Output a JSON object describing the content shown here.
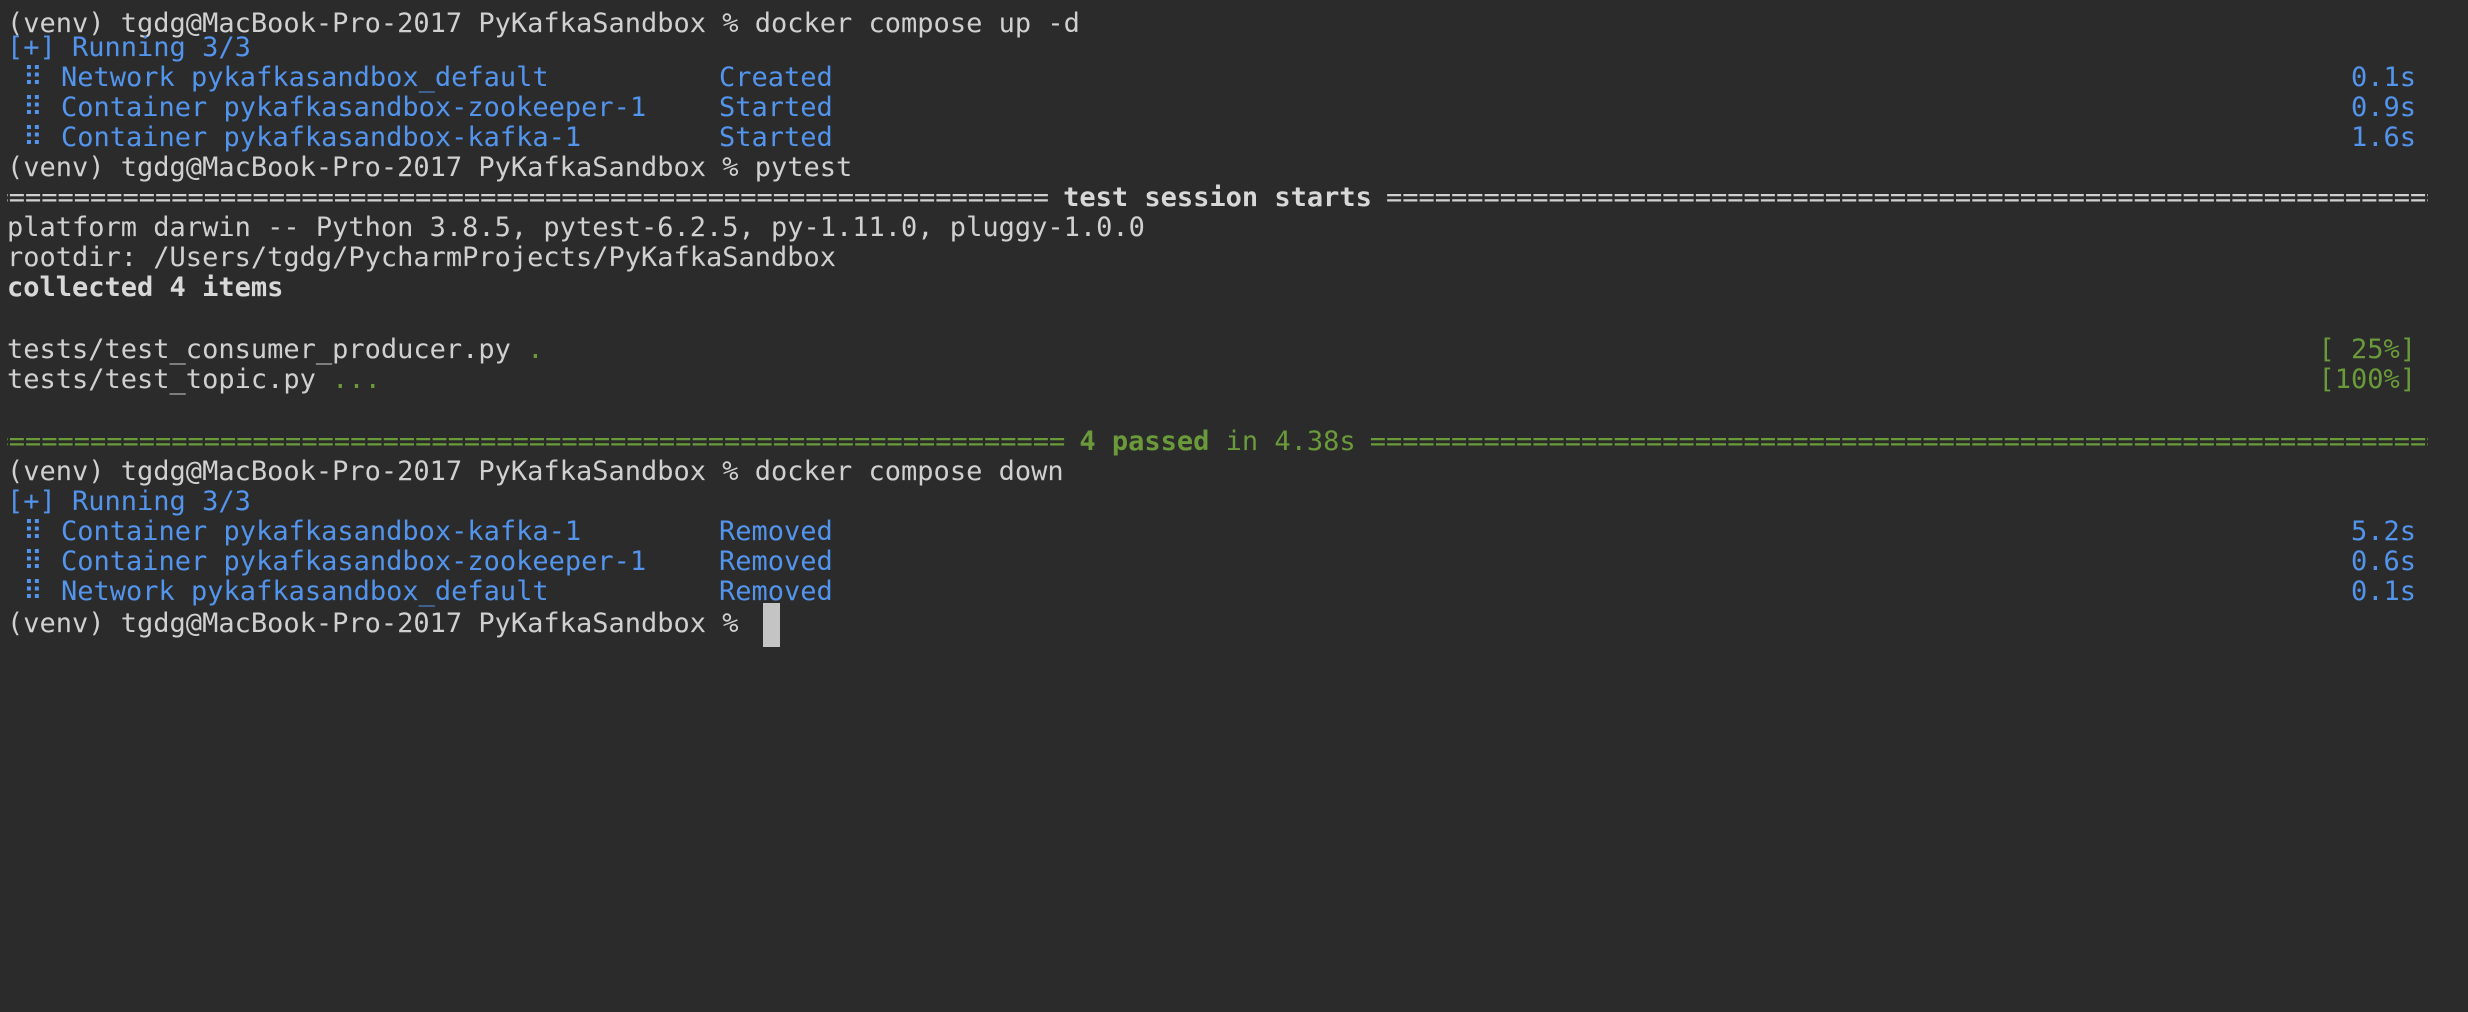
{
  "prompt": "(venv) tgdg@MacBook-Pro-2017 PyKafkaSandbox % ",
  "icons": {
    "row_marker": "braille-dots-icon",
    "cursor": "block-cursor"
  },
  "colors": {
    "background": "#2b2b2b",
    "text": "#d0d0d0",
    "blue": "#5394ec",
    "green": "#6a9a3a"
  },
  "cmd1": "docker compose up -d",
  "running1": "[+] Running 3/3",
  "up_rows": [
    {
      "marker": "⠿",
      "name": "Network pykafkasandbox_default",
      "status": "Created",
      "time": "0.1s"
    },
    {
      "marker": "⠿",
      "name": "Container pykafkasandbox-zookeeper-1",
      "status": "Started",
      "time": "0.9s"
    },
    {
      "marker": "⠿",
      "name": "Container pykafkasandbox-kafka-1",
      "status": "Started",
      "time": "1.6s"
    }
  ],
  "cmd2": "pytest",
  "session_title": "test session starts",
  "rule_fill": "==================================================================================================================",
  "platform": "platform darwin -- Python 3.8.5, pytest-6.2.5, py-1.11.0, pluggy-1.0.0",
  "rootdir": "rootdir: /Users/tgdg/PycharmProjects/PyKafkaSandbox",
  "collected": "collected 4 items",
  "tests": [
    {
      "file": "tests/test_consumer_producer.py",
      "dots": ".",
      "percent": "[ 25%]"
    },
    {
      "file": "tests/test_topic.py",
      "dots": "...",
      "percent": "[100%]"
    }
  ],
  "summary_passed": "4 passed",
  "summary_in": " in 4.38s",
  "cmd3": "docker compose down",
  "running2": "[+] Running 3/3",
  "down_rows": [
    {
      "marker": "⠿",
      "name": "Container pykafkasandbox-kafka-1",
      "status": "Removed",
      "time": "5.2s"
    },
    {
      "marker": "⠿",
      "name": "Container pykafkasandbox-zookeeper-1",
      "status": "Removed",
      "time": "0.6s"
    },
    {
      "marker": "⠿",
      "name": "Network pykafkasandbox_default",
      "status": "Removed",
      "time": "0.1s"
    }
  ]
}
